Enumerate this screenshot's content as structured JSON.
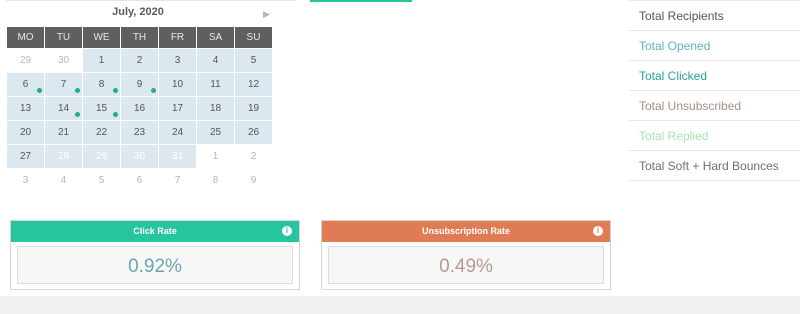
{
  "calendar": {
    "title": "July, 2020",
    "next_label": "▶",
    "weekdays": [
      "MO",
      "TU",
      "WE",
      "TH",
      "FR",
      "SA",
      "SU"
    ],
    "weeks": [
      [
        {
          "d": "29",
          "t": "other",
          "dot": false
        },
        {
          "d": "30",
          "t": "other",
          "dot": false
        },
        {
          "d": "1",
          "t": "in",
          "dot": false
        },
        {
          "d": "2",
          "t": "in",
          "dot": false
        },
        {
          "d": "3",
          "t": "in",
          "dot": false
        },
        {
          "d": "4",
          "t": "in",
          "dot": false
        },
        {
          "d": "5",
          "t": "in",
          "dot": false
        }
      ],
      [
        {
          "d": "6",
          "t": "in",
          "dot": true
        },
        {
          "d": "7",
          "t": "in",
          "dot": true
        },
        {
          "d": "8",
          "t": "in",
          "dot": true
        },
        {
          "d": "9",
          "t": "in",
          "dot": true
        },
        {
          "d": "10",
          "t": "in",
          "dot": false
        },
        {
          "d": "11",
          "t": "in",
          "dot": false
        },
        {
          "d": "12",
          "t": "in",
          "dot": false
        }
      ],
      [
        {
          "d": "13",
          "t": "in",
          "dot": false
        },
        {
          "d": "14",
          "t": "in",
          "dot": true
        },
        {
          "d": "15",
          "t": "in",
          "dot": true
        },
        {
          "d": "16",
          "t": "in",
          "dot": false
        },
        {
          "d": "17",
          "t": "in",
          "dot": false
        },
        {
          "d": "18",
          "t": "in",
          "dot": false
        },
        {
          "d": "19",
          "t": "in",
          "dot": false
        }
      ],
      [
        {
          "d": "20",
          "t": "in",
          "dot": false
        },
        {
          "d": "21",
          "t": "in",
          "dot": false
        },
        {
          "d": "22",
          "t": "in",
          "dot": false
        },
        {
          "d": "23",
          "t": "in",
          "dot": false
        },
        {
          "d": "24",
          "t": "in",
          "dot": false
        },
        {
          "d": "25",
          "t": "in",
          "dot": false
        },
        {
          "d": "26",
          "t": "in",
          "dot": false
        }
      ],
      [
        {
          "d": "27",
          "t": "in",
          "dot": false
        },
        {
          "d": "28",
          "t": "other-in",
          "dot": false
        },
        {
          "d": "29",
          "t": "other-in",
          "dot": false
        },
        {
          "d": "30",
          "t": "other-in",
          "dot": false
        },
        {
          "d": "31",
          "t": "other-in",
          "dot": false
        },
        {
          "d": "1",
          "t": "out",
          "dot": false
        },
        {
          "d": "2",
          "t": "out",
          "dot": false
        }
      ],
      [
        {
          "d": "3",
          "t": "out",
          "dot": false
        },
        {
          "d": "4",
          "t": "out",
          "dot": false
        },
        {
          "d": "5",
          "t": "out",
          "dot": false
        },
        {
          "d": "6",
          "t": "out",
          "dot": false
        },
        {
          "d": "7",
          "t": "out",
          "dot": false
        },
        {
          "d": "8",
          "t": "out",
          "dot": false
        },
        {
          "d": "9",
          "t": "out",
          "dot": false
        }
      ]
    ],
    "colors": {
      "header_bg": "#5f5f5f",
      "in_month_bg": "#dbe8ef",
      "event_dot": "#2aa88e"
    }
  },
  "stats": [
    {
      "label": "Total Recipients",
      "color": "#555555"
    },
    {
      "label": "Total Opened",
      "color": "#5bb2c0"
    },
    {
      "label": "Total Clicked",
      "color": "#2aa0a3"
    },
    {
      "label": "Total Unsubscribed",
      "color": "#a58f86"
    },
    {
      "label": "Total Replied",
      "color": "#a9dfb6"
    },
    {
      "label": "Total Soft + Hard Bounces",
      "color": "#7a6b66"
    }
  ],
  "click_rate": {
    "title": "Click Rate",
    "value": "0.92%",
    "header_color": "#27c4a0",
    "value_color": "#6aa6ad",
    "info_icon": "info-icon"
  },
  "unsub_rate": {
    "title": "Unsubscription Rate",
    "value": "0.49%",
    "header_color": "#e07c55",
    "value_color": "#b89a90",
    "info_icon": "info-icon"
  }
}
